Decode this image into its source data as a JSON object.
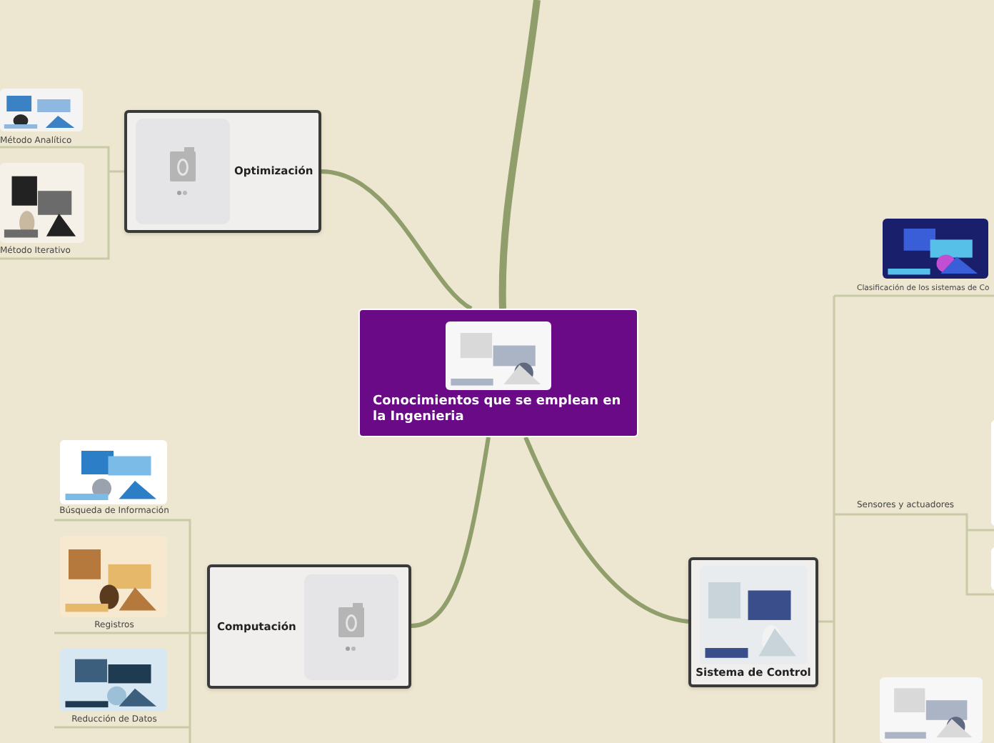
{
  "central": {
    "title": "Conocimientos que se emplean en la Ingenieria"
  },
  "topics": [
    {
      "title": "Optimización",
      "children": [
        {
          "label": "Método Analítico"
        },
        {
          "label": "Método Iterativo"
        }
      ]
    },
    {
      "title": "Computación",
      "children": [
        {
          "label": "Búsqueda de Información"
        },
        {
          "label": "Registros"
        },
        {
          "label": "Reducción de Datos"
        }
      ]
    },
    {
      "title": "Sistema de Control",
      "children": [
        {
          "label": "Clasificación de los sistemas de Co",
          "kind": "picture"
        },
        {
          "label": "Sensores y actuadores",
          "kind": "text"
        },
        {
          "kind": "picture"
        }
      ]
    }
  ]
}
